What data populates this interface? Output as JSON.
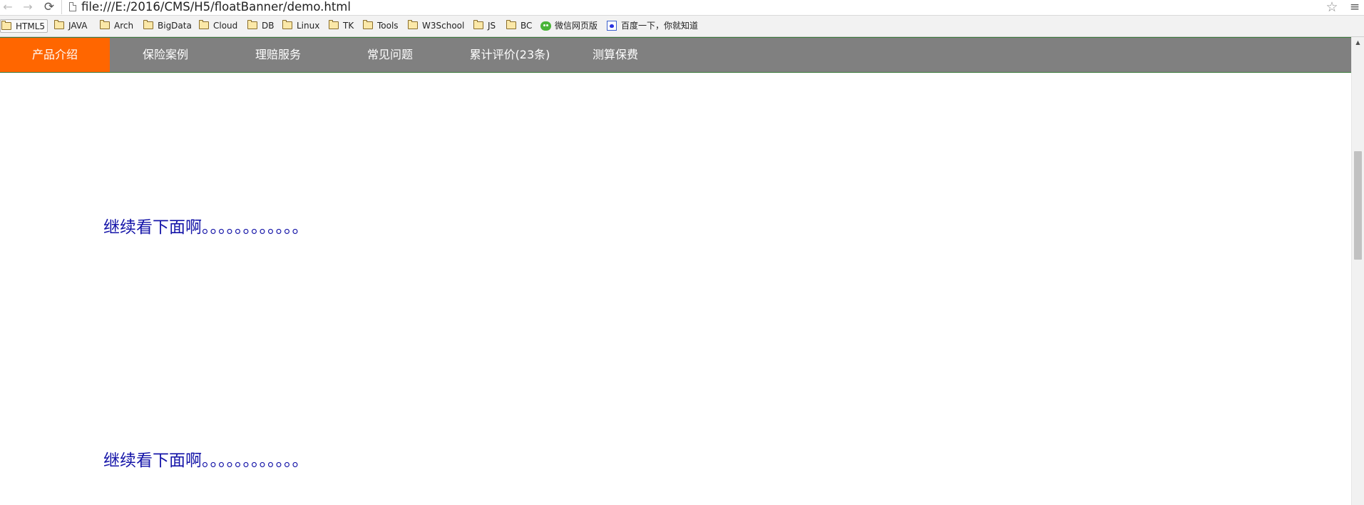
{
  "browser": {
    "url": "file:///E:/2016/CMS/H5/floatBanner/demo.html",
    "back_icon": "←",
    "forward_icon": "→",
    "reload_icon": "⟳",
    "star_icon": "☆",
    "menu_icon": "≡"
  },
  "bookmarks": [
    {
      "label": "HTML5",
      "icon": "folder-icon"
    },
    {
      "label": "JAVA",
      "icon": "folder-icon"
    },
    {
      "label": "Arch",
      "icon": "folder-icon"
    },
    {
      "label": "BigData",
      "icon": "folder-icon"
    },
    {
      "label": "Cloud",
      "icon": "folder-icon"
    },
    {
      "label": "DB",
      "icon": "folder-icon"
    },
    {
      "label": "Linux",
      "icon": "folder-icon"
    },
    {
      "label": "TK",
      "icon": "folder-icon"
    },
    {
      "label": "Tools",
      "icon": "folder-icon"
    },
    {
      "label": "W3School",
      "icon": "folder-icon"
    },
    {
      "label": "JS",
      "icon": "folder-icon"
    },
    {
      "label": "BC",
      "icon": "folder-icon"
    },
    {
      "label": "微信网页版",
      "icon": "wechat-icon"
    },
    {
      "label": "百度一下，你就知道",
      "icon": "baidu-icon"
    }
  ],
  "float_nav": {
    "active_color": "#ff6600",
    "background_color": "#808080",
    "items": [
      {
        "label": "产品介绍",
        "active": true
      },
      {
        "label": "保险案例",
        "active": false
      },
      {
        "label": "理赔服务",
        "active": false
      },
      {
        "label": "常见问题",
        "active": false
      },
      {
        "label": "累计评价(23条)",
        "active": false
      },
      {
        "label": "测算保费",
        "active": false
      }
    ]
  },
  "content": {
    "paragraphs": [
      "继续看下面啊。。。。。。。。。。。。",
      "继续看下面啊。。。。。。。。。。。。"
    ],
    "text_color": "#1515a8"
  },
  "scrollbar": {
    "up_icon": "▲"
  }
}
